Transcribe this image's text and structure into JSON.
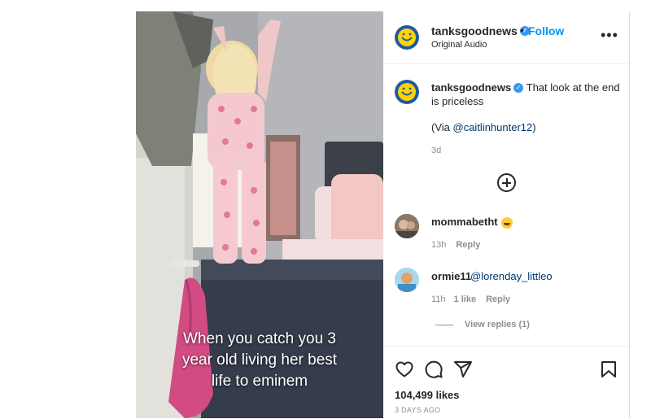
{
  "video": {
    "caption_lines": [
      "When you catch you 3",
      "year old living her best",
      "life to eminem"
    ]
  },
  "header": {
    "username": "tanksgoodnews",
    "separator": "•",
    "follow_label": "Follow",
    "subtitle": "Original Audio",
    "more_label": "•••"
  },
  "caption": {
    "username": "tanksgoodnews",
    "text": "That look at the end is priceless",
    "via_prefix": "(Via ",
    "via_mention": "@caitlinhunter12",
    "via_suffix": ")",
    "time": "3d"
  },
  "comments": [
    {
      "username": "mommabetht",
      "text": "",
      "time": "13h",
      "likes": "",
      "reply_label": "Reply"
    },
    {
      "username": "ormie11",
      "text": "@lorenday_littleo",
      "time": "11h",
      "likes": "1 like",
      "reply_label": "Reply"
    }
  ],
  "view_replies": "View replies (1)",
  "footer": {
    "likes": "104,499 likes",
    "date": "3 DAYS AGO"
  },
  "colors": {
    "accent": "#0095f6",
    "verified": "#3897f0",
    "avatar_brand": "#ffd400"
  },
  "icons": {
    "like": "heart-icon",
    "comment": "comment-icon",
    "share": "share-icon",
    "save": "bookmark-icon"
  }
}
